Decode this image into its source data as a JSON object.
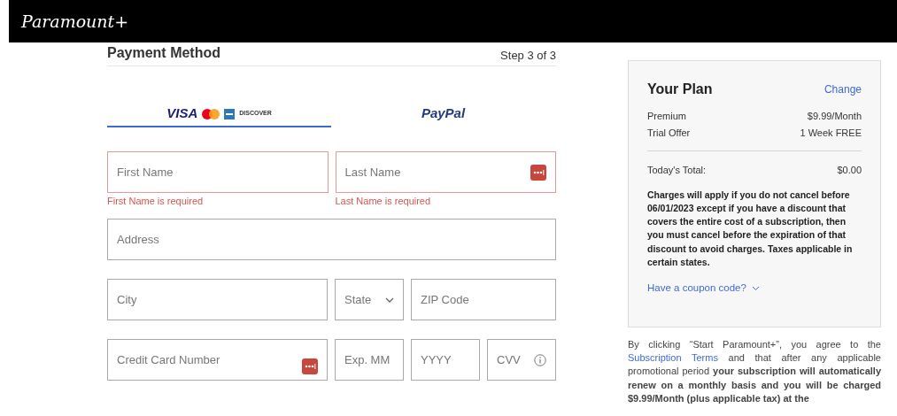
{
  "header": {
    "logo": "Paramount+"
  },
  "payment": {
    "title": "Payment Method",
    "step": "Step 3 of 3",
    "tabs": [
      {
        "kind": "cards",
        "brands": [
          "VISA",
          "DISCOVER"
        ],
        "selected": true
      },
      {
        "kind": "paypal",
        "label": "PayPal",
        "selected": false
      }
    ],
    "rows": [
      [
        {
          "kind": "text",
          "placeholder": "First Name",
          "error": "First Name is required",
          "autofill": false
        },
        {
          "kind": "text",
          "placeholder": "Last Name",
          "error": "Last Name is required",
          "autofill": true
        }
      ],
      [
        {
          "kind": "text",
          "placeholder": "Address",
          "autofill": false
        }
      ],
      [
        {
          "kind": "text",
          "placeholder": "City",
          "autofill": false
        },
        {
          "kind": "select",
          "placeholder": "State"
        },
        {
          "kind": "text",
          "placeholder": "ZIP Code",
          "autofill": false
        }
      ],
      [
        {
          "kind": "text",
          "placeholder": "Credit Card Number",
          "autofill": true
        },
        {
          "kind": "text",
          "placeholder": "Exp. MM",
          "autofill": false
        },
        {
          "kind": "text",
          "placeholder": "YYYY",
          "autofill": false
        },
        {
          "kind": "info",
          "placeholder": "CVV"
        }
      ]
    ]
  },
  "plan": {
    "title": "Your Plan",
    "change": "Change",
    "items": [
      {
        "label": "Premium",
        "value": "$9.99/Month"
      },
      {
        "label": "Trial Offer",
        "value": "1 Week FREE"
      }
    ],
    "total": {
      "label": "Today's Total:",
      "value": "$0.00"
    },
    "notice": "Charges will apply if you do not cancel before 06/01/2023 except if you have a discount that covers the entire cost of a subscription, then you must cancel before the expiration of that discount to avoid charges. Taxes applicable in certain states.",
    "coupon": "Have a coupon code?"
  },
  "terms": {
    "before": "By clicking “Start Paramount+”, you agree to the",
    "link": "Subscription Terms",
    "after": "and that after any applicable promotional period **your subscription will automatically renew on a monthly basis and you will be charged $9.99/Month (plus applicable tax) at the**"
  }
}
